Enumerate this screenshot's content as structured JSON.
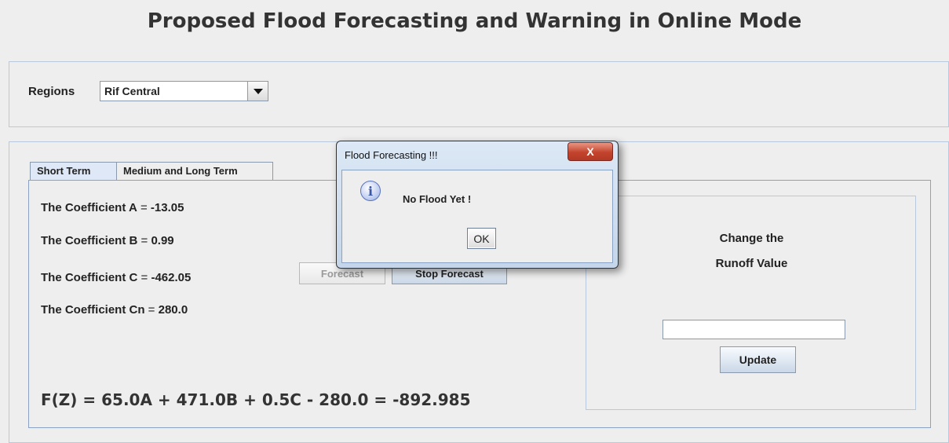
{
  "app": {
    "title": "Proposed Flood Forecasting and Warning in Online Mode"
  },
  "regions": {
    "label": "Regions",
    "selected": "Rif Central"
  },
  "tabs": [
    {
      "label": "Short Term",
      "active": true
    },
    {
      "label": "Medium and Long Term",
      "active": false
    }
  ],
  "coefficients": {
    "a": {
      "label": "The Coefficient A",
      "eq": " = ",
      "value": "-13.05"
    },
    "b": {
      "label": "The Coefficient B",
      "eq": " = ",
      "value": "0.99"
    },
    "c": {
      "label": "The Coefficient C",
      "eq": " = ",
      "value": "-462.05"
    },
    "cn": {
      "label": "The Coefficient Cn",
      "eq": " = ",
      "value": "280.0"
    }
  },
  "buttons": {
    "forecast": "Forecast",
    "stop_forecast": "Stop Forecast",
    "update": "Update"
  },
  "formula": "F(Z) = 65.0A + 471.0B + 0.5C - 280.0 = -892.985",
  "runoff": {
    "title_line1": "Change the",
    "title_line2": "Runoff Value",
    "input_value": ""
  },
  "dialog": {
    "title": "Flood Forecasting !!!",
    "message": "No Flood Yet !",
    "ok": "OK",
    "close": "X"
  },
  "colors": {
    "accent": "#dfe8f6",
    "close_button": "#c4432d"
  }
}
